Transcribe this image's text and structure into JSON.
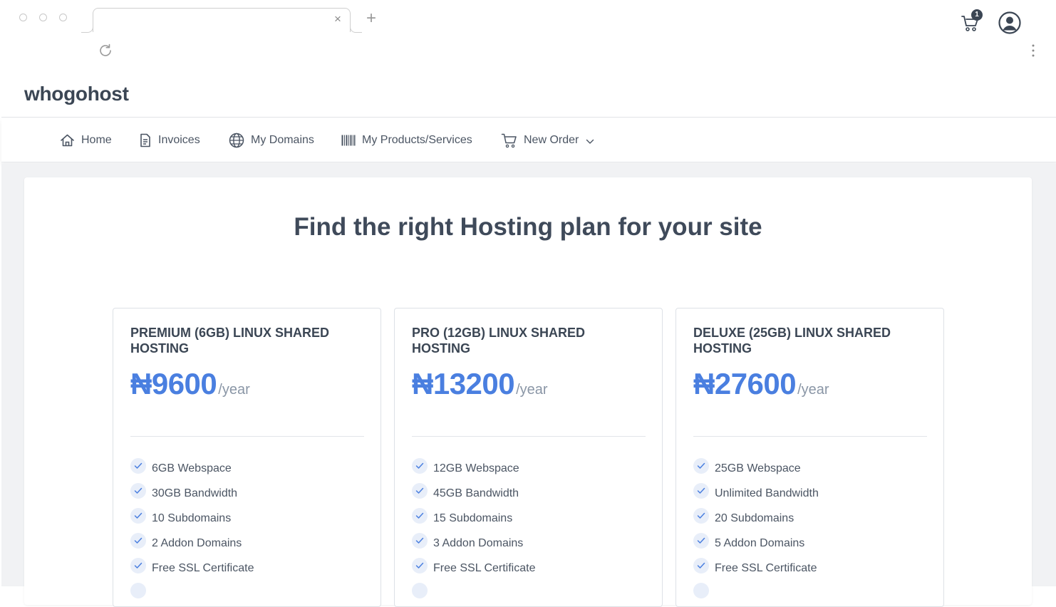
{
  "browser": {
    "tab_title": "",
    "close_glyph": "×",
    "new_tab_glyph": "+"
  },
  "header": {
    "logo": "whogohost",
    "cart_count": "1"
  },
  "nav": {
    "items": [
      {
        "label": "Home",
        "icon": "home-icon"
      },
      {
        "label": "Invoices",
        "icon": "invoice-icon"
      },
      {
        "label": "My Domains",
        "icon": "globe-icon"
      },
      {
        "label": "My Products/Services",
        "icon": "barcode-icon"
      },
      {
        "label": "New Order",
        "icon": "cart-icon"
      }
    ]
  },
  "main": {
    "title": "Find the right Hosting plan for your site",
    "plans": [
      {
        "name": "PREMIUM (6GB) LINUX SHARED HOSTING",
        "price": "₦9600",
        "period": "/year",
        "features": [
          "6GB Webspace",
          "30GB Bandwidth",
          "10 Subdomains",
          "2 Addon Domains",
          "Free SSL Certificate"
        ]
      },
      {
        "name": "PRO (12GB) LINUX SHARED HOSTING",
        "price": "₦13200",
        "period": "/year",
        "features": [
          "12GB Webspace",
          "45GB Bandwidth",
          "15 Subdomains",
          "3 Addon Domains",
          "Free SSL Certificate"
        ]
      },
      {
        "name": "DELUXE (25GB) LINUX SHARED HOSTING",
        "price": "₦27600",
        "period": "/year",
        "features": [
          "25GB Webspace",
          "Unlimited Bandwidth",
          "20 Subdomains",
          "5 Addon Domains",
          "Free SSL Certificate"
        ]
      }
    ]
  },
  "colors": {
    "accent": "#4a7fe0",
    "text_dark": "#3b4654",
    "background": "#f1f2f4"
  }
}
